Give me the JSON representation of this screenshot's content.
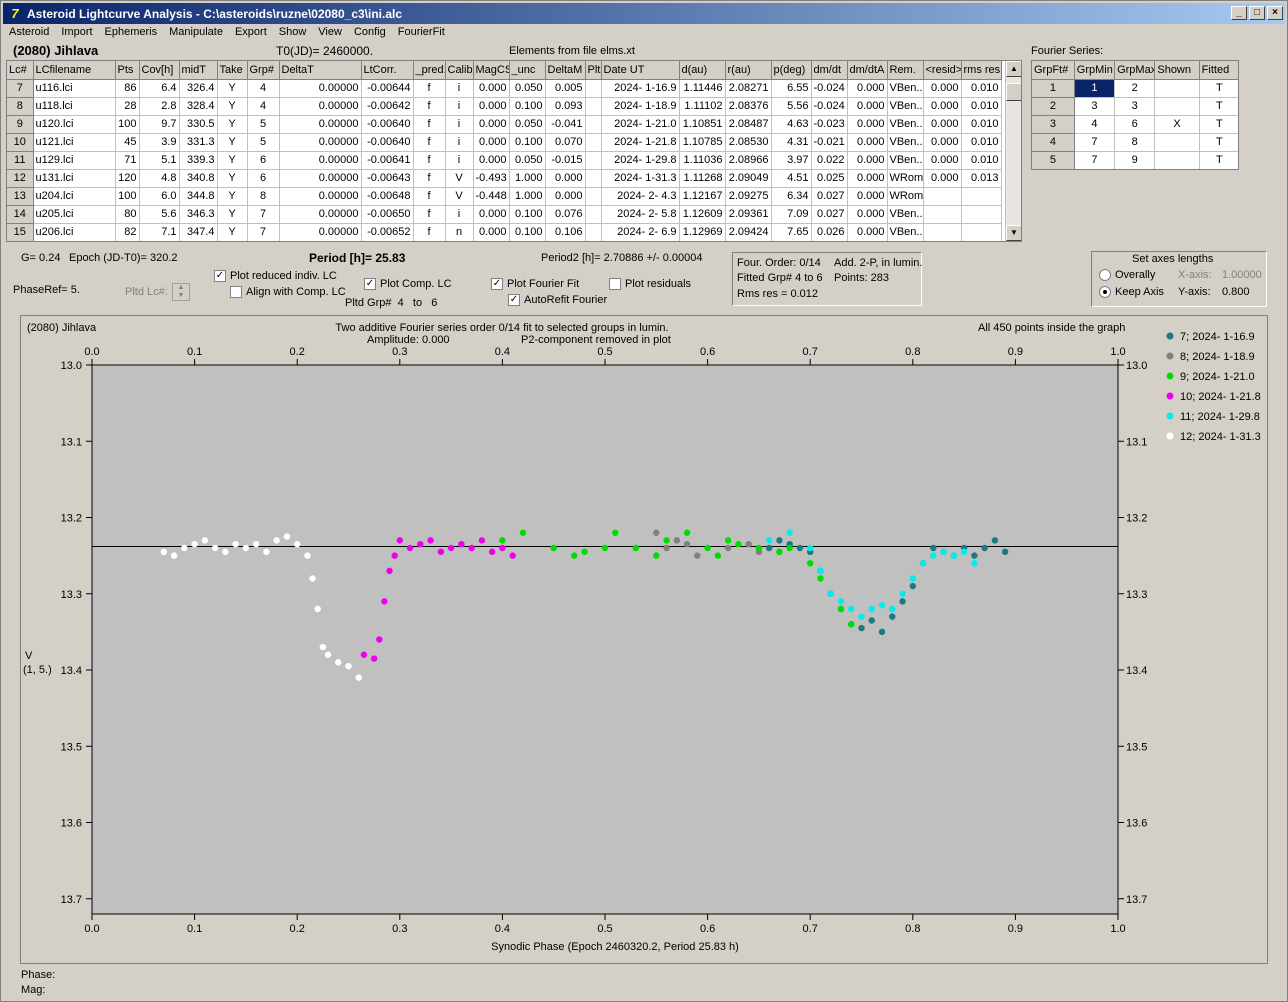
{
  "window": {
    "title": "Asteroid Lightcurve Analysis - C:\\asteroids\\ruzne\\02080_c3\\ini.alc",
    "icon_glyph": "7"
  },
  "menu": [
    "Asteroid",
    "Import",
    "Ephemeris",
    "Manipulate",
    "Export",
    "Show",
    "View",
    "Config",
    "FourierFit"
  ],
  "header": {
    "asteroid": "(2080) Jihlava",
    "t0": "T0(JD)= 2460000.",
    "elements": "Elements from file elms.xt"
  },
  "lc_table": {
    "columns": [
      "Lc#",
      "LCfilename",
      "Pts",
      "Cov[h]",
      "midT",
      "Take",
      "Grp#",
      "DeltaT",
      "LtCorr.",
      "_pred.",
      "Calib.",
      "MagCS",
      "_unc",
      "DeltaM",
      "Plt",
      "Date UT",
      "d(au)",
      "r(au)",
      "p(deg)",
      "dm/dt",
      "dm/dtA",
      "Rem.",
      "<resid>",
      "rms res"
    ],
    "rows": [
      [
        "7",
        "u116.lci",
        "86",
        "6.4",
        "326.4",
        "Y",
        "4",
        "0.00000",
        "-0.00644",
        "f",
        "i",
        "0.000",
        "0.050",
        "0.005",
        "",
        "2024- 1-16.9",
        "1.11446",
        "2.08271",
        "6.55",
        "-0.024",
        "0.000",
        "VBen..",
        "0.000",
        "0.010"
      ],
      [
        "8",
        "u118.lci",
        "28",
        "2.8",
        "328.4",
        "Y",
        "4",
        "0.00000",
        "-0.00642",
        "f",
        "i",
        "0.000",
        "0.100",
        "0.093",
        "",
        "2024- 1-18.9",
        "1.11102",
        "2.08376",
        "5.56",
        "-0.024",
        "0.000",
        "VBen..",
        "0.000",
        "0.010"
      ],
      [
        "9",
        "u120.lci",
        "100",
        "9.7",
        "330.5",
        "Y",
        "5",
        "0.00000",
        "-0.00640",
        "f",
        "i",
        "0.000",
        "0.050",
        "-0.041",
        "",
        "2024- 1-21.0",
        "1.10851",
        "2.08487",
        "4.63",
        "-0.023",
        "0.000",
        "VBen..",
        "0.000",
        "0.010"
      ],
      [
        "10",
        "u121.lci",
        "45",
        "3.9",
        "331.3",
        "Y",
        "5",
        "0.00000",
        "-0.00640",
        "f",
        "i",
        "0.000",
        "0.100",
        "0.070",
        "",
        "2024- 1-21.8",
        "1.10785",
        "2.08530",
        "4.31",
        "-0.021",
        "0.000",
        "VBen..",
        "0.000",
        "0.010"
      ],
      [
        "11",
        "u129.lci",
        "71",
        "5.1",
        "339.3",
        "Y",
        "6",
        "0.00000",
        "-0.00641",
        "f",
        "i",
        "0.000",
        "0.050",
        "-0.015",
        "",
        "2024- 1-29.8",
        "1.11036",
        "2.08966",
        "3.97",
        "0.022",
        "0.000",
        "VBen..",
        "0.000",
        "0.010"
      ],
      [
        "12",
        "u131.lci",
        "120",
        "4.8",
        "340.8",
        "Y",
        "6",
        "0.00000",
        "-0.00643",
        "f",
        "V",
        "-0.493",
        "1.000",
        "0.000",
        "",
        "2024- 1-31.3",
        "1.11268",
        "2.09049",
        "4.51",
        "0.025",
        "0.000",
        "WRom",
        "0.000",
        "0.013"
      ],
      [
        "13",
        "u204.lci",
        "100",
        "6.0",
        "344.8",
        "Y",
        "8",
        "0.00000",
        "-0.00648",
        "f",
        "V",
        "-0.448",
        "1.000",
        "0.000",
        "",
        "2024- 2- 4.3",
        "1.12167",
        "2.09275",
        "6.34",
        "0.027",
        "0.000",
        "WRom",
        "",
        ""
      ],
      [
        "14",
        "u205.lci",
        "80",
        "5.6",
        "346.3",
        "Y",
        "7",
        "0.00000",
        "-0.00650",
        "f",
        "i",
        "0.000",
        "0.100",
        "0.076",
        "",
        "2024- 2- 5.8",
        "1.12609",
        "2.09361",
        "7.09",
        "0.027",
        "0.000",
        "VBen..",
        "",
        ""
      ],
      [
        "15",
        "u206.lci",
        "82",
        "7.1",
        "347.4",
        "Y",
        "7",
        "0.00000",
        "-0.00652",
        "f",
        "n",
        "0.000",
        "0.100",
        "0.106",
        "",
        "2024- 2- 6.9",
        "1.12969",
        "2.09424",
        "7.65",
        "0.026",
        "0.000",
        "VBen..",
        "",
        ""
      ]
    ]
  },
  "fourier": {
    "title": "Fourier Series:",
    "columns": [
      "GrpFt#",
      "GrpMin",
      "GrpMax",
      "Shown",
      "Fitted"
    ],
    "rows": [
      [
        "1",
        "1",
        "2",
        "",
        "T"
      ],
      [
        "2",
        "3",
        "3",
        "",
        "T"
      ],
      [
        "3",
        "4",
        "6",
        "X",
        "T"
      ],
      [
        "4",
        "7",
        "8",
        "",
        "T"
      ],
      [
        "5",
        "7",
        "9",
        "",
        "T"
      ]
    ]
  },
  "controls": {
    "g": "G= 0.24",
    "epoch": "Epoch (JD-T0)= 320.2",
    "period": "Period [h]= 25.83",
    "period2": "Period2 [h]= 2.70886 +/- 0.00004",
    "phaseref": "PhaseRef= 5.",
    "pltd_lc": "Pltd Lc#:",
    "plot_reduced": "Plot reduced indiv. LC",
    "align_comp": "Align with Comp. LC",
    "plot_comp": "Plot Comp. LC",
    "pltd_grp": "Pltd Grp#",
    "grp_from": "4",
    "grp_to_label": "to",
    "grp_to": "6",
    "plot_fourier": "Plot Fourier Fit",
    "plot_residuals": "Plot residuals",
    "autorefit": "AutoRefit Fourier",
    "four_order": "Four. Order:  0/14",
    "add_2p": "Add. 2-P, in lumin.",
    "fitted_grp": "Fitted Grp# 4 to 6",
    "points": "Points: 283",
    "rms": "Rms res      = 0.012",
    "axes_title": "Set axes lengths",
    "overally": "Overally",
    "keep_axis": "Keep Axis",
    "xaxis_label": "X-axis:",
    "xaxis_val": "1.00000",
    "yaxis_label": "Y-axis:",
    "yaxis_val": "0.800"
  },
  "plot": {
    "title_left": "(2080) Jihlava",
    "title_center1": "Two additive Fourier series order 0/14 fit to selected groups in lumin.",
    "title_center2a": "Amplitude: 0.000",
    "title_center2b": "P2-component removed in plot",
    "title_right": "All 450 points inside the graph",
    "ylabel1": "V",
    "ylabel2": "(1, 5.)",
    "xlabel": "Synodic Phase (Epoch 2460320.2, Period 25.83 h)",
    "footer_phase": "Phase:",
    "footer_mag": "Mag:"
  },
  "chart_data": {
    "type": "scatter",
    "x_range": [
      0,
      1
    ],
    "y_range": [
      13.72,
      13.0
    ],
    "y_inverted": true,
    "x_ticks": [
      "0.0",
      "0.1",
      "0.2",
      "0.3",
      "0.4",
      "0.5",
      "0.6",
      "0.7",
      "0.8",
      "0.9",
      "1.0"
    ],
    "y_ticks": [
      "13.0",
      "13.1",
      "13.2",
      "13.3",
      "13.4",
      "13.5",
      "13.6",
      "13.7"
    ],
    "fit_line_y": 13.238,
    "series": [
      {
        "name": "7; 2024- 1-16.9",
        "color": "#1a7a80",
        "points": [
          [
            0.66,
            13.24
          ],
          [
            0.67,
            13.23
          ],
          [
            0.68,
            13.235
          ],
          [
            0.69,
            13.24
          ],
          [
            0.7,
            13.245
          ],
          [
            0.71,
            13.27
          ],
          [
            0.72,
            13.3
          ],
          [
            0.73,
            13.32
          ],
          [
            0.74,
            13.34
          ],
          [
            0.75,
            13.345
          ],
          [
            0.76,
            13.335
          ],
          [
            0.77,
            13.35
          ],
          [
            0.78,
            13.33
          ],
          [
            0.79,
            13.31
          ],
          [
            0.8,
            13.29
          ],
          [
            0.81,
            13.26
          ],
          [
            0.82,
            13.24
          ],
          [
            0.83,
            13.245
          ],
          [
            0.84,
            13.25
          ],
          [
            0.85,
            13.24
          ],
          [
            0.86,
            13.25
          ],
          [
            0.87,
            13.24
          ],
          [
            0.88,
            13.23
          ],
          [
            0.89,
            13.245
          ]
        ]
      },
      {
        "name": "8; 2024- 1-18.9",
        "color": "#808080",
        "points": [
          [
            0.55,
            13.22
          ],
          [
            0.56,
            13.24
          ],
          [
            0.57,
            13.23
          ],
          [
            0.58,
            13.235
          ],
          [
            0.59,
            13.25
          ],
          [
            0.62,
            13.24
          ],
          [
            0.64,
            13.235
          ],
          [
            0.65,
            13.245
          ]
        ]
      },
      {
        "name": "9; 2024- 1-21.0",
        "color": "#00dd00",
        "points": [
          [
            0.4,
            13.23
          ],
          [
            0.42,
            13.22
          ],
          [
            0.45,
            13.24
          ],
          [
            0.47,
            13.25
          ],
          [
            0.48,
            13.245
          ],
          [
            0.5,
            13.24
          ],
          [
            0.51,
            13.22
          ],
          [
            0.53,
            13.24
          ],
          [
            0.55,
            13.25
          ],
          [
            0.56,
            13.23
          ],
          [
            0.58,
            13.22
          ],
          [
            0.6,
            13.24
          ],
          [
            0.61,
            13.25
          ],
          [
            0.62,
            13.23
          ],
          [
            0.63,
            13.235
          ],
          [
            0.65,
            13.24
          ],
          [
            0.67,
            13.245
          ],
          [
            0.68,
            13.24
          ],
          [
            0.7,
            13.26
          ],
          [
            0.71,
            13.28
          ],
          [
            0.73,
            13.32
          ],
          [
            0.74,
            13.34
          ]
        ]
      },
      {
        "name": "10; 2024- 1-21.8",
        "color": "#ee00ee",
        "points": [
          [
            0.265,
            13.38
          ],
          [
            0.275,
            13.385
          ],
          [
            0.28,
            13.36
          ],
          [
            0.285,
            13.31
          ],
          [
            0.29,
            13.27
          ],
          [
            0.295,
            13.25
          ],
          [
            0.3,
            13.23
          ],
          [
            0.31,
            13.24
          ],
          [
            0.32,
            13.235
          ],
          [
            0.33,
            13.23
          ],
          [
            0.34,
            13.245
          ],
          [
            0.35,
            13.24
          ],
          [
            0.36,
            13.235
          ],
          [
            0.37,
            13.24
          ],
          [
            0.38,
            13.23
          ],
          [
            0.39,
            13.245
          ],
          [
            0.4,
            13.24
          ],
          [
            0.41,
            13.25
          ]
        ]
      },
      {
        "name": "11; 2024- 1-29.8",
        "color": "#00eeee",
        "points": [
          [
            0.66,
            13.23
          ],
          [
            0.68,
            13.22
          ],
          [
            0.7,
            13.24
          ],
          [
            0.71,
            13.27
          ],
          [
            0.72,
            13.3
          ],
          [
            0.73,
            13.31
          ],
          [
            0.74,
            13.32
          ],
          [
            0.75,
            13.33
          ],
          [
            0.76,
            13.32
          ],
          [
            0.77,
            13.315
          ],
          [
            0.78,
            13.32
          ],
          [
            0.79,
            13.3
          ],
          [
            0.8,
            13.28
          ],
          [
            0.81,
            13.26
          ],
          [
            0.82,
            13.25
          ],
          [
            0.83,
            13.245
          ],
          [
            0.84,
            13.25
          ],
          [
            0.85,
            13.245
          ],
          [
            0.86,
            13.26
          ]
        ]
      },
      {
        "name": "12; 2024- 1-31.3",
        "color": "#ffffff",
        "points": [
          [
            0.07,
            13.245
          ],
          [
            0.08,
            13.25
          ],
          [
            0.09,
            13.24
          ],
          [
            0.1,
            13.235
          ],
          [
            0.11,
            13.23
          ],
          [
            0.12,
            13.24
          ],
          [
            0.13,
            13.245
          ],
          [
            0.14,
            13.235
          ],
          [
            0.15,
            13.24
          ],
          [
            0.16,
            13.235
          ],
          [
            0.17,
            13.245
          ],
          [
            0.18,
            13.23
          ],
          [
            0.19,
            13.225
          ],
          [
            0.2,
            13.235
          ],
          [
            0.21,
            13.25
          ],
          [
            0.215,
            13.28
          ],
          [
            0.22,
            13.32
          ],
          [
            0.225,
            13.37
          ],
          [
            0.23,
            13.38
          ],
          [
            0.24,
            13.39
          ],
          [
            0.25,
            13.395
          ],
          [
            0.26,
            13.41
          ]
        ]
      }
    ]
  }
}
